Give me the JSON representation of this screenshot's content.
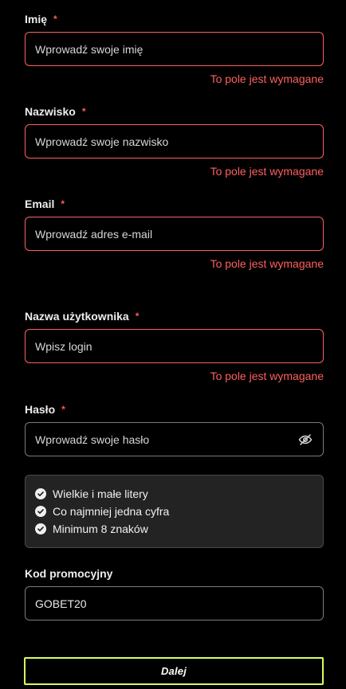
{
  "form": {
    "fields": {
      "first_name": {
        "label": "Imię",
        "required_marker": "*",
        "placeholder": "Wprowadź swoje imię",
        "error": "To pole jest wymagane"
      },
      "last_name": {
        "label": "Nazwisko",
        "required_marker": "*",
        "placeholder": "Wprowadź swoje nazwisko",
        "error": "To pole jest wymagane"
      },
      "email": {
        "label": "Email",
        "required_marker": "*",
        "placeholder": "Wprowadź adres e-mail",
        "error": "To pole jest wymagane"
      },
      "username": {
        "label": "Nazwa użytkownika",
        "required_marker": "*",
        "placeholder": "Wpisz login",
        "error": "To pole jest wymagane"
      },
      "password": {
        "label": "Hasło",
        "required_marker": "*",
        "placeholder": "Wprowadź swoje hasło",
        "toggle_icon": "eye-off-icon"
      },
      "promo_code": {
        "label": "Kod promocyjny",
        "value": "GOBET20"
      }
    },
    "password_rules": [
      "Wielkie i małe litery",
      "Co najmniej jedna cyfra",
      "Minimum 8 znaków"
    ],
    "submit_label": "Dalej"
  },
  "colors": {
    "background": "#000000",
    "error": "#ff5f5f",
    "accent": "#d9ff5a",
    "input_border": "#7b7b7b",
    "rules_panel": "#232323"
  }
}
